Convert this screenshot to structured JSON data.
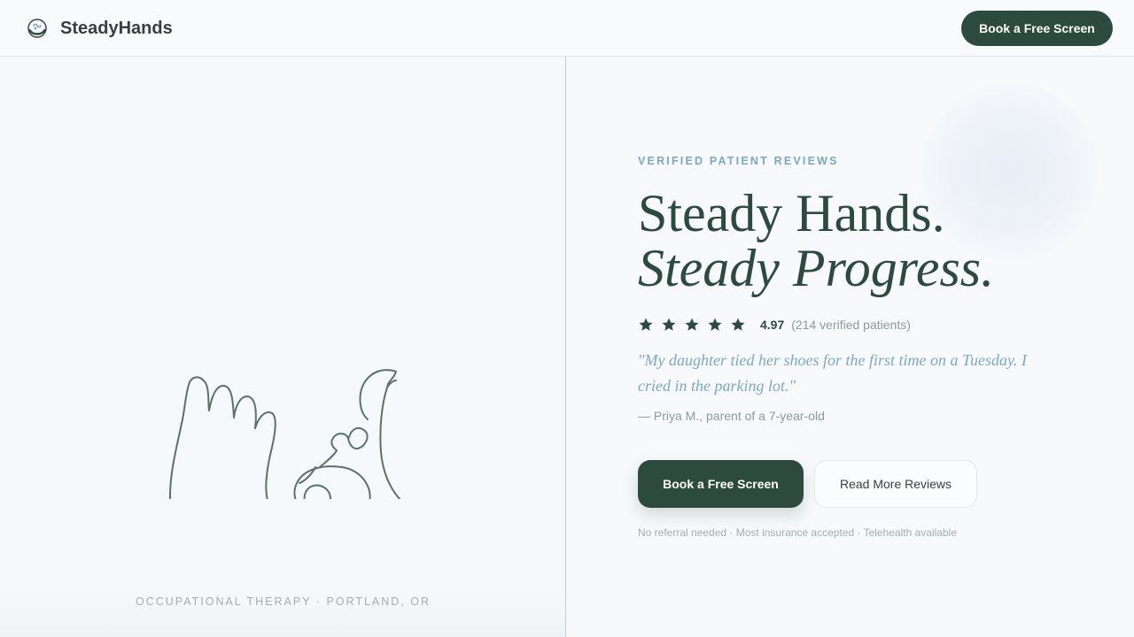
{
  "colors": {
    "brand_green": "#2d4a3e",
    "accent_blue": "#7ba9bd",
    "muted_text": "#8e9a98",
    "divider": "#b9d3dc"
  },
  "header": {
    "logo_icon": "hands-circle-icon",
    "brand_name": "SteadyHands",
    "cta_label": "Book a Free Screen"
  },
  "left": {
    "illustration_icon": "hand-line-drawing-icon",
    "location": "OCCUPATIONAL THERAPY · PORTLAND, OR"
  },
  "hero": {
    "eyebrow": "VERIFIED PATIENT REVIEWS",
    "headline_line1": "Steady Hands.",
    "headline_line2": "Steady Progress.",
    "rating": {
      "stars": 5,
      "star_icon": "star-icon",
      "score": "4.97",
      "count": "(214 verified patients)"
    },
    "quote": "\"My daughter tied her shoes for the first time on a Tuesday. I cried in the parking lot.\"",
    "attribution": "— Priya M., parent of a 7-year-old",
    "primary_cta": "Book a Free Screen",
    "secondary_cta": "Read More Reviews",
    "fineprint": "No referral needed · Most insurance accepted · Telehealth available"
  }
}
